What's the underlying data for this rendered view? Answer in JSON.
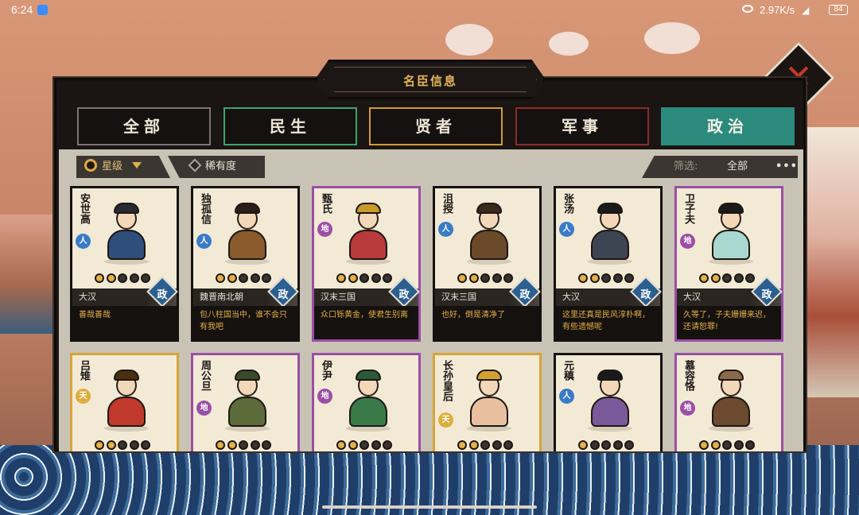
{
  "status_bar": {
    "time": "6:24",
    "net_speed": "2.97K/s",
    "battery": "84"
  },
  "dialog": {
    "title": "名臣信息"
  },
  "tabs": [
    {
      "label": "全部",
      "color": "#7a7570"
    },
    {
      "label": "民生",
      "color": "#3fa36a"
    },
    {
      "label": "贤者",
      "color": "#d49a35"
    },
    {
      "label": "军事",
      "color": "#8a2c2a"
    },
    {
      "label": "政治",
      "color": "#2c8a7d",
      "active": true
    }
  ],
  "filters": {
    "sort_star": "星级",
    "sort_rarity": "稀有度",
    "filter_label": "筛选:",
    "filter_value": "全部",
    "more": "•••"
  },
  "cards": [
    {
      "name": "安世高",
      "grade": "人",
      "grade_type": "ren",
      "stars": 2,
      "era": "大汉",
      "role": "政",
      "quote": "善哉善哉",
      "frame": "black",
      "robe": "#2f4e7a",
      "hat": "#2a2a33"
    },
    {
      "name": "独孤信",
      "grade": "人",
      "grade_type": "ren",
      "stars": 2,
      "era": "魏晋南北朝",
      "role": "政",
      "quote": "包八柱国当中，谁不会只有我吧",
      "frame": "black",
      "robe": "#8a5a2c",
      "hat": "#2a2018"
    },
    {
      "name": "甄氏",
      "grade": "地",
      "grade_type": "di",
      "stars": 2,
      "era": "汉末三国",
      "role": "政",
      "quote": "众口铄黄金，使君生别离",
      "frame": "purple",
      "robe": "#b83a3a",
      "hat": "#c99a2a"
    },
    {
      "name": "沮授",
      "grade": "人",
      "grade_type": "ren",
      "stars": 2,
      "era": "汉末三国",
      "role": "政",
      "quote": "也好，倒是清净了",
      "frame": "black",
      "robe": "#6b4a2a",
      "hat": "#3a2a1a"
    },
    {
      "name": "张汤",
      "grade": "人",
      "grade_type": "ren",
      "stars": 2,
      "era": "大汉",
      "role": "政",
      "quote": "这里还真是民风淳朴啊，有些遗憾呢",
      "frame": "black",
      "robe": "#3d4552",
      "hat": "#1a1a1a"
    },
    {
      "name": "卫子夫",
      "grade": "地",
      "grade_type": "di",
      "stars": 2,
      "era": "大汉",
      "role": "政",
      "quote": "久等了，子夫姗姗来迟，还请恕罪!",
      "frame": "purple",
      "robe": "#a8d8d0",
      "hat": "#1a1a1a"
    },
    {
      "name": "吕雉",
      "grade": "天",
      "grade_type": "tian",
      "stars": 2,
      "era": "",
      "role": "",
      "quote": "",
      "frame": "gold",
      "robe": "#c0392b",
      "hat": "#4a3010"
    },
    {
      "name": "周公旦",
      "grade": "地",
      "grade_type": "di",
      "stars": 2,
      "era": "",
      "role": "",
      "quote": "",
      "frame": "purple",
      "robe": "#5c6b3a",
      "hat": "#3a4a2a"
    },
    {
      "name": "伊尹",
      "grade": "地",
      "grade_type": "di",
      "stars": 2,
      "era": "",
      "role": "",
      "quote": "",
      "frame": "purple",
      "robe": "#3a7a4a",
      "hat": "#2a5a3a"
    },
    {
      "name": "长孙皇后",
      "grade": "天",
      "grade_type": "tian",
      "stars": 2,
      "era": "",
      "role": "",
      "quote": "",
      "frame": "gold",
      "robe": "#e8c0a0",
      "hat": "#d4a030"
    },
    {
      "name": "元稹",
      "grade": "人",
      "grade_type": "ren",
      "stars": 1,
      "era": "",
      "role": "",
      "quote": "",
      "frame": "black",
      "robe": "#7a5a9a",
      "hat": "#1a1a1a"
    },
    {
      "name": "慕容恪",
      "grade": "地",
      "grade_type": "di",
      "stars": 2,
      "era": "",
      "role": "",
      "quote": "",
      "frame": "purple",
      "robe": "#6b4a30",
      "hat": "#8a6a4a"
    }
  ]
}
